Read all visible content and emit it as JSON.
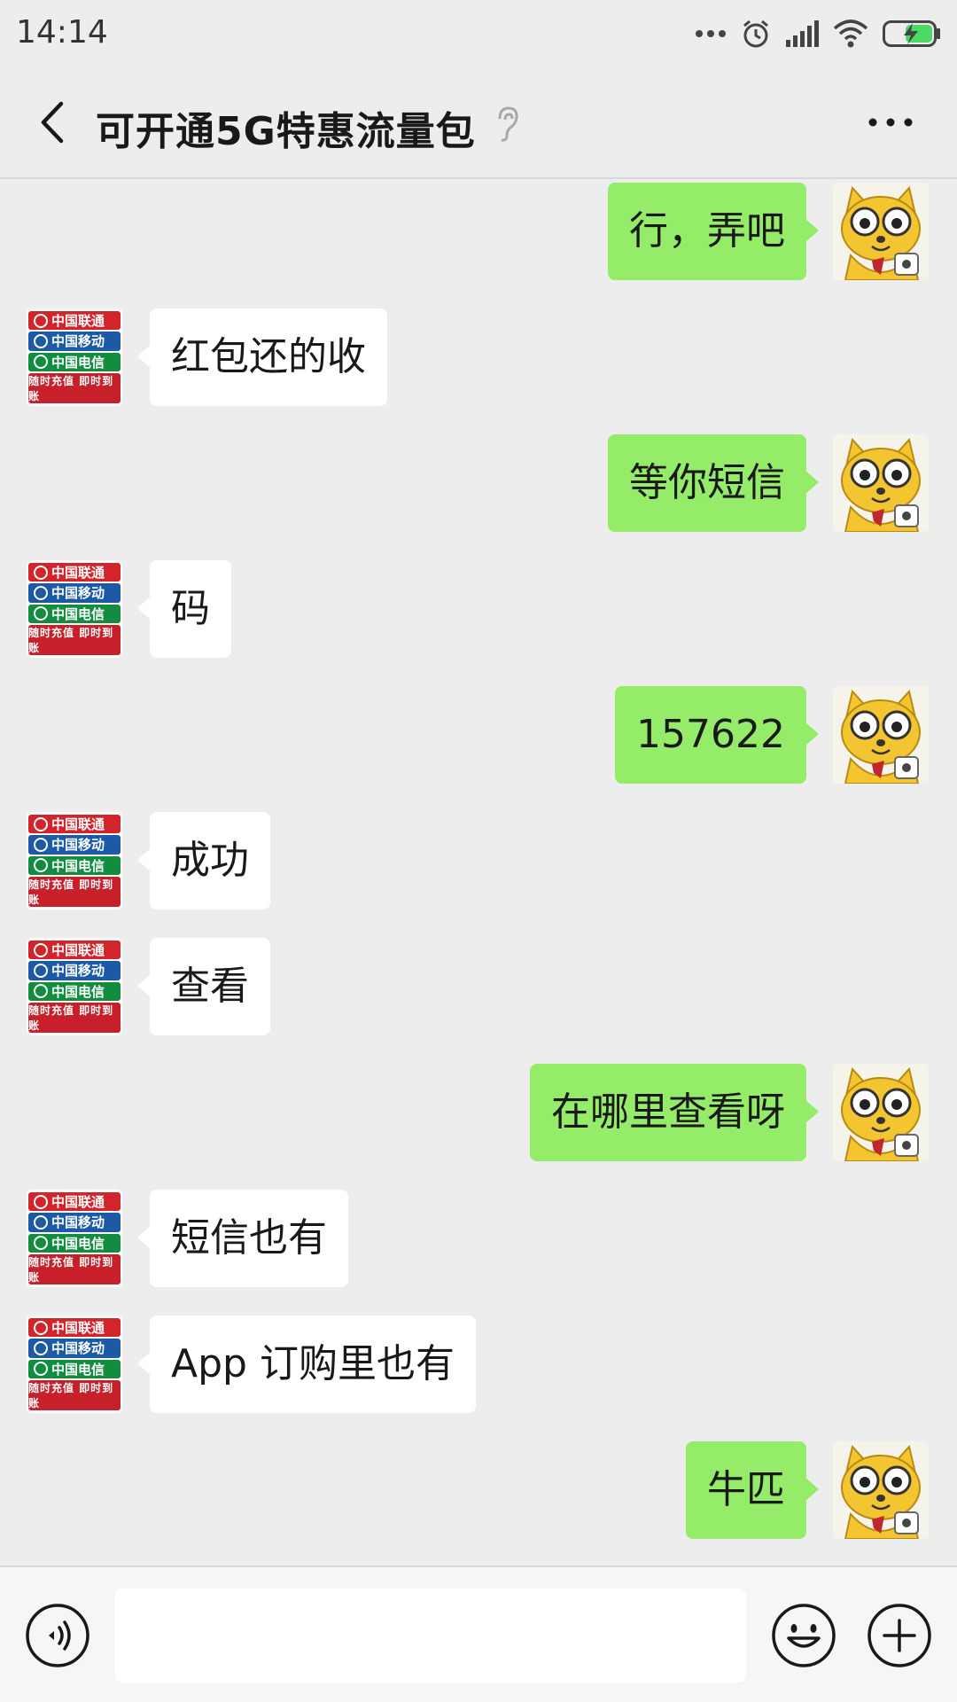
{
  "status_bar": {
    "time": "14:14",
    "icons": [
      "more-dots-icon",
      "alarm-icon",
      "signal-icon",
      "wifi-icon",
      "battery-charging-icon"
    ]
  },
  "header": {
    "title": "可开通5G特惠流量包",
    "back_icon": "chevron-left-icon",
    "earpiece_icon": "ear-icon",
    "more_icon": "more-horizontal-icon"
  },
  "contact_avatar_text": {
    "row1": "中国联通",
    "row2": "中国移动",
    "row3": "中国电信",
    "footer": "随时充值 即时到账"
  },
  "messages": [
    {
      "from": "me",
      "text": "行，弄吧"
    },
    {
      "from": "them",
      "text": "红包还的收"
    },
    {
      "from": "me",
      "text": "等你短信"
    },
    {
      "from": "them",
      "text": "码"
    },
    {
      "from": "me",
      "text": "157622"
    },
    {
      "from": "them",
      "text": "成功"
    },
    {
      "from": "them",
      "text": "查看"
    },
    {
      "from": "me",
      "text": "在哪里查看呀"
    },
    {
      "from": "them",
      "text": "短信也有"
    },
    {
      "from": "them",
      "text": "App 订购里也有"
    },
    {
      "from": "me",
      "text": "牛匹"
    }
  ],
  "input_bar": {
    "voice_icon": "voice-icon",
    "input_value": "",
    "emoji_icon": "emoji-icon",
    "plus_icon": "plus-circle-icon"
  },
  "colors": {
    "background": "#ededed",
    "sent_bubble": "#95ec69",
    "received_bubble": "#ffffff"
  }
}
